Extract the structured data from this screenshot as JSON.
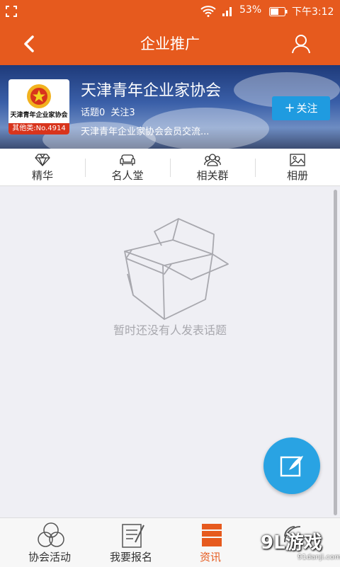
{
  "status": {
    "battery": "53%",
    "time": "下午3:12"
  },
  "nav": {
    "title": "企业推广"
  },
  "org": {
    "name": "天津青年企业家协会",
    "logo_text": "天津青年企业家协会",
    "rank": "其他类:No.4914",
    "topics": "话题0",
    "follows": "关注3",
    "desc": "天津青年企业家协会会员交流..."
  },
  "follow_button": {
    "label": "关注"
  },
  "tabs": [
    {
      "label": "精华",
      "icon": "diamond-icon"
    },
    {
      "label": "名人堂",
      "icon": "sofa-icon"
    },
    {
      "label": "相关群",
      "icon": "group-icon"
    },
    {
      "label": "相册",
      "icon": "image-icon"
    }
  ],
  "empty": {
    "message": "暂时还没有人发表话题",
    "icon": "empty-box-icon"
  },
  "bottom_nav": [
    {
      "label": "协会活动",
      "icon": "circles-icon"
    },
    {
      "label": "我要报名",
      "icon": "form-icon"
    },
    {
      "label": "资讯",
      "icon": "news-icon",
      "active": true
    },
    {
      "label": "",
      "icon": "signal-icon"
    }
  ],
  "watermark": {
    "main": "9L游戏",
    "sub": "91danji.com"
  },
  "colors": {
    "primary": "#e65a1e",
    "accent": "#29a3e3",
    "follow": "#1f9be0"
  }
}
